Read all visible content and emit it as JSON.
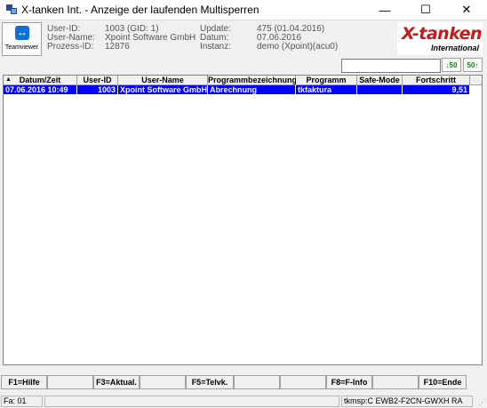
{
  "window": {
    "title": "X-tanken Int. - Anzeige der laufenden Multisperren",
    "minimize": "—",
    "maximize": "☐",
    "close": "✕"
  },
  "teamviewer": {
    "label": "Teamviewer"
  },
  "info": {
    "user_id_label": "User-ID:",
    "user_id": "1003 (GID: 1)",
    "user_name_label": "User-Name:",
    "user_name": "Xpoint Software GmbH",
    "prozess_id_label": "Prozess-ID:",
    "prozess_id": "12876",
    "update_label": "Update:",
    "update": "475 (01.04.2016)",
    "datum_label": "Datum:",
    "datum": "07.06.2016",
    "instanz_label": "Instanz:",
    "instanz": "demo (Xpoint)(acu0)"
  },
  "logo": {
    "main": "X-tanken",
    "sub": "International"
  },
  "toolbar": {
    "search_value": "",
    "btn1": "↓50",
    "btn2": "50↑"
  },
  "table": {
    "columns": [
      "Datum/Zeit",
      "User-ID",
      "User-Name",
      "Programmbezeichnung",
      "Programm",
      "Safe-Mode",
      "Fortschritt"
    ],
    "rows": [
      [
        "07.06.2016 10:49",
        "1003",
        "Xpoint Software GmbH",
        "Abrechnung",
        "tkfaktura",
        "",
        "9,51"
      ]
    ]
  },
  "fkeys": {
    "f1": "F1=Hilfe",
    "f3": "F3=Aktual.",
    "f5": "F5=Telvk.",
    "f8": "F8=F-Info",
    "f10": "F10=Ende"
  },
  "status": {
    "left": "Fa: 01",
    "right": "tkmsp:C EWB2-F2CN-GWXH RA"
  }
}
